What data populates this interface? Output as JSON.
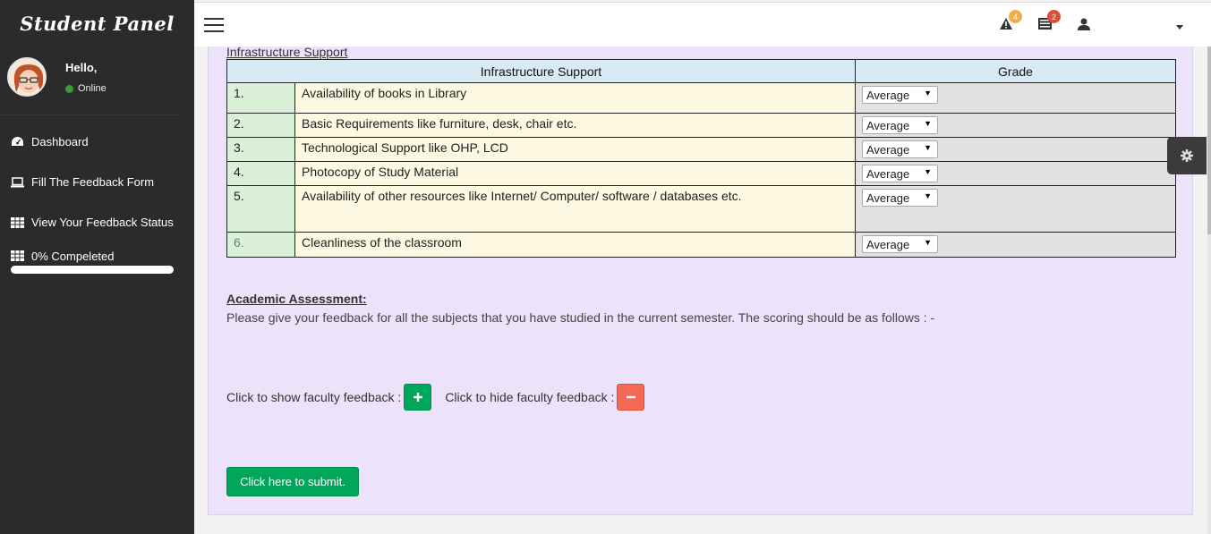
{
  "sidebar": {
    "brand": "Student Panel",
    "user": {
      "greeting": "Hello,",
      "status": "Online"
    },
    "menu": [
      {
        "label": "Dashboard",
        "icon": "dashboard-icon"
      },
      {
        "label": "Fill The Feedback Form",
        "icon": "laptop-icon"
      },
      {
        "label": "View Your Feedback Status",
        "icon": "table-icon"
      }
    ],
    "progress": {
      "label": "0% Compeleted",
      "icon": "table-icon",
      "percent": 0
    }
  },
  "topbar": {
    "alerts_badge": "4",
    "tasks_badge": "2",
    "colors": {
      "alerts_badge": "#f0ad4e",
      "tasks_badge": "#dd4b39"
    }
  },
  "infrastructure": {
    "section_title": "Infrastructure Support",
    "headers": {
      "item": "Infrastructure Support",
      "grade": "Grade"
    },
    "rows": [
      {
        "num": "1.",
        "desc": "Availability of books in Library",
        "grade": "Average"
      },
      {
        "num": "2.",
        "desc": "Basic Requirements like furniture, desk, chair etc.",
        "grade": "Average"
      },
      {
        "num": "3.",
        "desc": "Technological Support like OHP, LCD",
        "grade": "Average"
      },
      {
        "num": "4.",
        "desc": "Photocopy of Study Material",
        "grade": "Average"
      },
      {
        "num": "5.",
        "desc": "Availability of other resources like Internet/ Computer/ software / databases etc.",
        "grade": "Average"
      },
      {
        "num": "6.",
        "desc": "Cleanliness of the classroom",
        "grade": "Average"
      }
    ]
  },
  "academic": {
    "title": "Academic Assessment:",
    "text": "Please give your feedback for all the subjects that you have studied in the current semester. The scoring should be as follows : -",
    "show_label": "Click to show faculty feedback :",
    "hide_label": "Click to hide faculty feedback :"
  },
  "submit_label": "Click here to submit."
}
